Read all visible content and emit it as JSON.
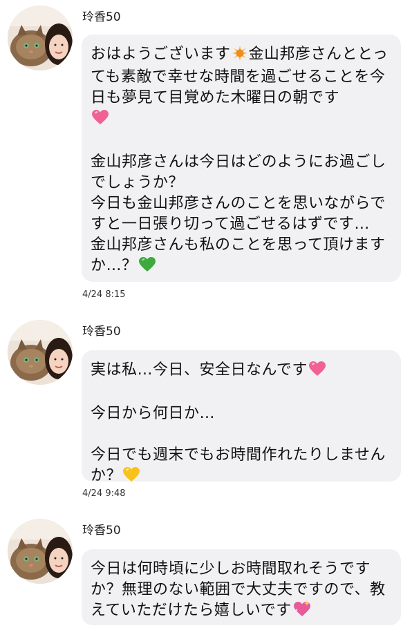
{
  "sender_name": "玲香50",
  "messages": [
    {
      "part1": "おはようございます",
      "part2": "金山邦彦さんととっても素敵で幸せな時間を過ごせることを今日も夢見て目覚めた木曜日の朝です",
      "part3": "\n\n金山邦彦さんは今日はどのようにお過ごしでしょうか？\n今日も金山邦彦さんのことを思いながらですと一日張り切って過ごせるはずです…\n金山邦彦さんも私のことを思って頂けますか…？",
      "emojis": [
        "sun-icon",
        "pink-heart-icon",
        "green-heart-icon"
      ],
      "time": "4/24 8:15"
    },
    {
      "part1": "実は私…今日、安全日なんです",
      "part2": "\n\n今日から何日か…\n\n今日でも週末でもお時間作れたりしませんか？",
      "emojis": [
        "pink-heart-icon",
        "yellow-heart-icon"
      ],
      "time": "4/24 9:48"
    },
    {
      "part1": "今日は何時頃に少しお時間取れそうですか？無理のない範囲で大丈夫ですので、教えていただけたら嬉しいです",
      "emojis": [
        "sparkling-heart-icon"
      ],
      "time": ""
    }
  ],
  "colors": {
    "bubble": "#f1f1f3",
    "pink_heart": "#f06292",
    "green_heart": "#3caa3c",
    "yellow_heart": "#f8c21a",
    "sun": "#f5b82e"
  }
}
